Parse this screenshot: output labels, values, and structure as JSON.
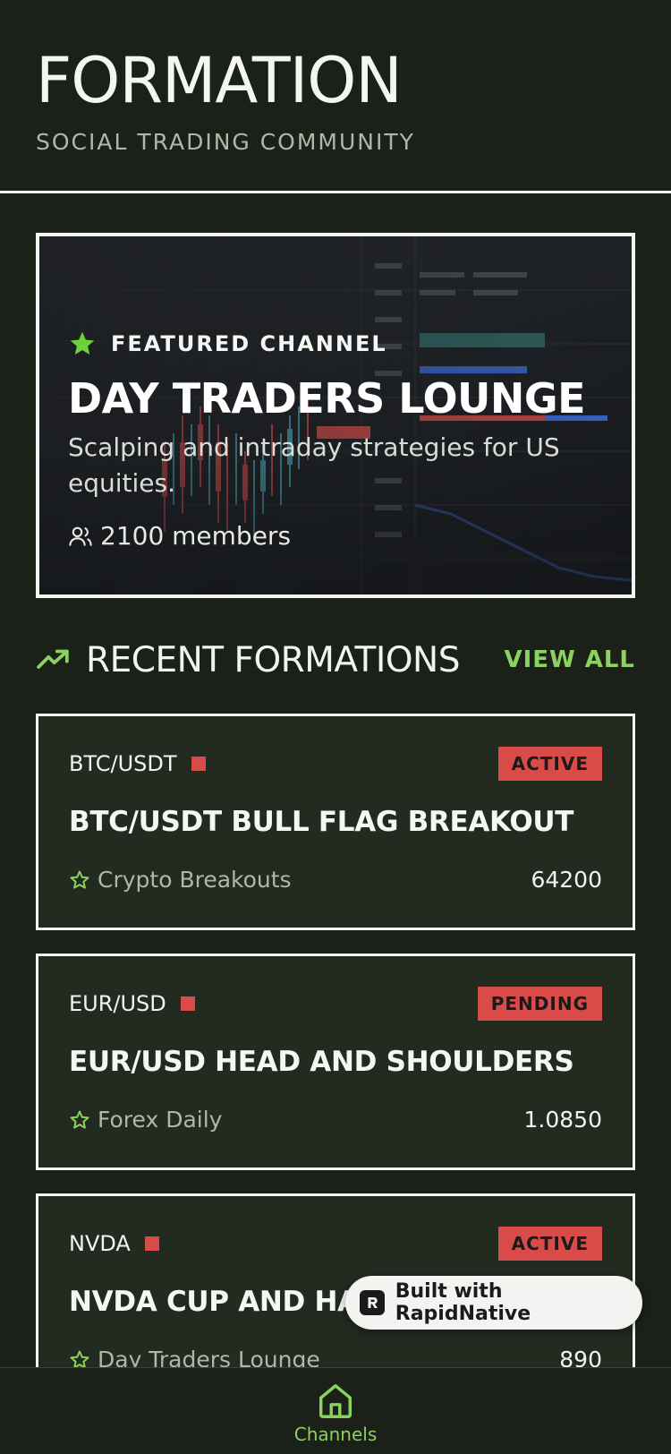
{
  "header": {
    "title": "FORMATION",
    "tagline": "SOCIAL TRADING COMMUNITY"
  },
  "featured": {
    "label": "FEATURED CHANNEL",
    "title": "DAY TRADERS LOUNGE",
    "description": "Scalping and intraday strategies for US equities.",
    "members": "2100 members"
  },
  "section": {
    "title": "RECENT FORMATIONS",
    "view_all": "VIEW ALL"
  },
  "formations": [
    {
      "pair": "BTC/USDT",
      "status": "ACTIVE",
      "title": "BTC/USDT BULL FLAG BREAKOUT",
      "channel": "Crypto Breakouts",
      "price": "64200"
    },
    {
      "pair": "EUR/USD",
      "status": "PENDING",
      "title": "EUR/USD HEAD AND SHOULDERS",
      "channel": "Forex Daily",
      "price": "1.0850"
    },
    {
      "pair": "NVDA",
      "status": "ACTIVE",
      "title": "NVDA CUP AND HANDLE",
      "channel": "Day Traders Lounge",
      "price": "890"
    }
  ],
  "built_with": "Built with RapidNative",
  "bottom_nav": {
    "items": [
      {
        "label": "Channels",
        "icon": "home-icon",
        "active": true
      }
    ]
  },
  "colors": {
    "background": "#1b2118",
    "card": "#232a20",
    "accent_green": "#8bd25f",
    "badge_red": "#d94b48",
    "border": "#f3f5f1"
  }
}
